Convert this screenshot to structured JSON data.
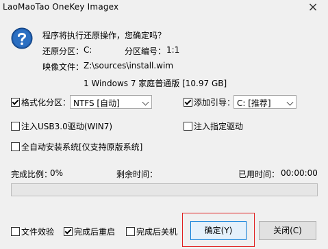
{
  "window": {
    "title": "LaoMaoTao OneKey Imagex",
    "close_glyph": "×"
  },
  "info": {
    "question": "程序将执行还原操作，您确定吗？",
    "restore_partition_label": "还原分区：",
    "restore_partition_value": "C:",
    "partition_number_label": "分区编号：",
    "partition_number_value": "1:1",
    "image_file_label": "映像文件：",
    "image_file_value": "Z:\\sources\\install.wim",
    "image_desc": "1 Windows 7 家庭普通版 [10.97 GB]"
  },
  "options": {
    "format_label": "格式化分区：",
    "format_checked": true,
    "format_value": "NTFS [自动]",
    "boot_label": "添加引导：",
    "boot_checked": true,
    "boot_value": "C: [推荐]",
    "usb3_label": "注入USB3.0驱动(WIN7)",
    "usb3_checked": false,
    "inject_driver_label": "注入指定驱动",
    "inject_driver_checked": false,
    "auto_install_label": "全自动安装系统[仅支持原版系统]",
    "auto_install_checked": false
  },
  "status": {
    "ratio_label": "完成比例：",
    "ratio_value": "0%",
    "remaining_label": "剩余时间：",
    "remaining_value": "",
    "elapsed_label": "已用时间：",
    "elapsed_value": "00:00:00",
    "progress_fraction": 0
  },
  "footer": {
    "verify_label": "文件效验",
    "verify_checked": false,
    "reboot_label": "完成后重启",
    "reboot_checked": true,
    "shutdown_label": "完成后关机",
    "shutdown_checked": false,
    "ok_label": "确定(Y)",
    "close_label": "关闭(C)"
  },
  "colors": {
    "progress_fill": "#06b025",
    "focus_border": "#e02020",
    "icon_blue": "#1e5aa8"
  },
  "icons": {
    "question": "question-icon"
  }
}
